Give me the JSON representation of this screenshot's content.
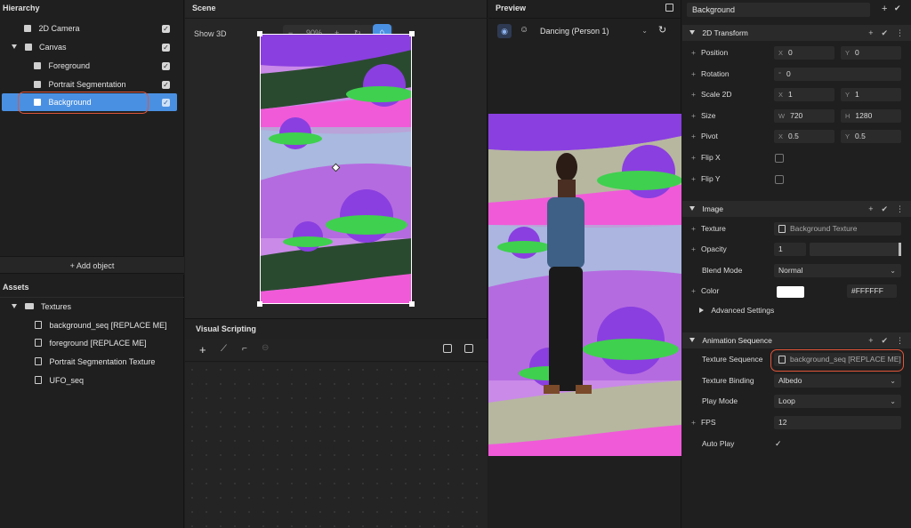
{
  "hierarchy": {
    "title": "Hierarchy",
    "items": [
      {
        "label": "2D Camera"
      },
      {
        "label": "Canvas"
      },
      {
        "label": "Foreground"
      },
      {
        "label": "Portrait Segmentation"
      },
      {
        "label": "Background"
      }
    ],
    "add_object_label": "+ Add object"
  },
  "assets": {
    "title": "Assets",
    "folder": "Textures",
    "items": [
      {
        "label": "background_seq [REPLACE ME]"
      },
      {
        "label": "foreground [REPLACE ME]"
      },
      {
        "label": "Portrait Segmentation Texture"
      },
      {
        "label": "UFO_seq"
      }
    ]
  },
  "scene": {
    "title": "Scene",
    "show3d_label": "Show 3D",
    "zoom": "90%",
    "minus": "−",
    "plus": "+"
  },
  "visual_scripting": {
    "title": "Visual Scripting",
    "add_label": "+"
  },
  "preview": {
    "title": "Preview",
    "model_select": "Dancing (Person 1)"
  },
  "inspector": {
    "object_name": "Background",
    "transform": {
      "title": "2D Transform",
      "position_label": "Position",
      "position_x": "0",
      "position_y": "0",
      "rotation_label": "Rotation",
      "rotation_value": "0",
      "scale_label": "Scale 2D",
      "scale_x": "1",
      "scale_y": "1",
      "size_label": "Size",
      "size_w": "720",
      "size_h": "1280",
      "pivot_label": "Pivot",
      "pivot_x": "0.5",
      "pivot_y": "0.5",
      "flipx_label": "Flip X",
      "flipy_label": "Flip Y",
      "axis_x": "X",
      "axis_y": "Y",
      "axis_w": "W",
      "axis_h": "H",
      "axis_deg": "°"
    },
    "image": {
      "title": "Image",
      "texture_label": "Texture",
      "texture_value": "Background Texture",
      "opacity_label": "Opacity",
      "opacity_value": "1",
      "blend_label": "Blend Mode",
      "blend_value": "Normal",
      "color_label": "Color",
      "color_hex": "#FFFFFF",
      "color_swatch": "#ffffff",
      "advanced_label": "Advanced Settings"
    },
    "animation": {
      "title": "Animation Sequence",
      "texture_seq_label": "Texture Sequence",
      "texture_seq_value": "background_seq [REPLACE ME]",
      "binding_label": "Texture Binding",
      "binding_value": "Albedo",
      "play_mode_label": "Play Mode",
      "play_mode_value": "Loop",
      "fps_label": "FPS",
      "fps_value": "12",
      "autoplay_label": "Auto Play"
    }
  },
  "colors": {
    "accent": "#4a90e2",
    "highlight_ring": "#e2553a",
    "art_purple": "#8a3fe0",
    "art_pink": "#f05ad8",
    "art_lilac": "#c98ae8",
    "art_green": "#3fd04f"
  }
}
